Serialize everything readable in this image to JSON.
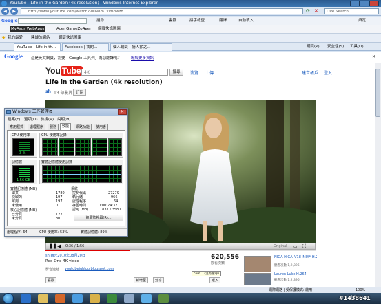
{
  "browser": {
    "title": "YouTube - Life in the Garden (4k resolution) - Windows Internet Explorer",
    "address": "http://www.youtube.com/watch?v=N8m1ximdwz8",
    "live_search": "Live Search",
    "google_label": "Google",
    "google_tools": [
      "搜尋",
      "書籤",
      "拼字檢查",
      "翻譯",
      "自動填入",
      "設定"
    ],
    "asus_items": [
      "MyAsus WebApps",
      "Acer GameZone",
      "Acer",
      "網頁快訊圖庫"
    ],
    "favorites_label": "我的最愛",
    "favorites_items": [
      "建議的網站",
      "網頁快訊圖庫"
    ],
    "tabs": [
      "YouTube - Life in th...",
      "Facebook | 我的...",
      "個人網頁 | 情人節之..."
    ],
    "command_items": [
      "網頁(P)",
      "安全性(S)",
      "工具(O)"
    ],
    "translate_text": "這是英文網頁，需要「Google 工具列」為您翻譯嗎？",
    "translate_link": "瞭解更多資訊",
    "status_text": "網際網路 | 受保護模式: 啟用",
    "zoom": "100%"
  },
  "youtube": {
    "logo_you": "You",
    "logo_tube": "Tube",
    "search_value": "4K",
    "search_button": "搜尋",
    "browse": "瀏覽",
    "upload": "上傳",
    "create_account": "建立帳戶",
    "sign_in": "登入",
    "video_title": "Life in the Garden (4k resolution)",
    "channel": "sh",
    "video_count": "13 部影片",
    "subscribe": "訂閱",
    "time": "0:36 / 1:56",
    "quality": "Original",
    "uploader_date": "sh  西元2010年08月20日",
    "description": "Red One 4K video",
    "url_label": "影音連結",
    "url_value": "youtubejgblog.blogspot.com",
    "views": "620,556",
    "views_label": "觀看次數",
    "like": "喜歡",
    "share": "分享",
    "embed": "嵌入",
    "add": "新增至",
    "comment_search": "com... (沒有搜尋)",
    "related": [
      {
        "title": "NIGA HIGA_V18_MIX*-H.264.mov",
        "meta": "觀看次數 1,2,396"
      },
      {
        "title": "Lauren Luke H.264",
        "meta": "觀看次數 1,2,396"
      }
    ]
  },
  "taskmgr": {
    "title": "Windows 工作管理員",
    "menu": [
      "檔案(F)",
      "選項(O)",
      "檢視(V)",
      "說明(H)"
    ],
    "tabs": [
      "應用程式",
      "處理程序",
      "服務",
      "效能",
      "網路功能",
      "使用者"
    ],
    "active_tab": "效能",
    "cpu_label": "CPU 使用率",
    "cpu_value": "3 %",
    "cpu_history": "CPU 使用率記錄",
    "mem_label": "記憶體",
    "mem_value": "1.56 GB",
    "mem_history": "實體記憶體使用記錄",
    "physical_header": "實體記憶體 (MB)",
    "physical": [
      [
        "總共",
        "1780"
      ],
      [
        "快取的",
        "197"
      ],
      [
        "可用",
        "197"
      ],
      [
        "未使用",
        "0"
      ]
    ],
    "kernel_header": "核心記憶體 (MB)",
    "kernel": [
      [
        "已分頁",
        "127"
      ],
      [
        "未分頁",
        "30"
      ]
    ],
    "system_header": "系統",
    "system": [
      [
        "控制代碼",
        "27279"
      ],
      [
        "執行緒",
        "966"
      ],
      [
        "處理程序",
        "64"
      ],
      [
        "存留時間",
        "0:00:24:32"
      ],
      [
        "認可 (MB)",
        "1837 / 3580"
      ]
    ],
    "resmon_button": "資源監視器(R)...",
    "status": [
      "處理程序: 64",
      "CPU 使用率: 53%",
      "實體記憶體: 89%"
    ]
  },
  "taskbar": {
    "clock": "上午 11:14",
    "watermark": "#1438641"
  }
}
